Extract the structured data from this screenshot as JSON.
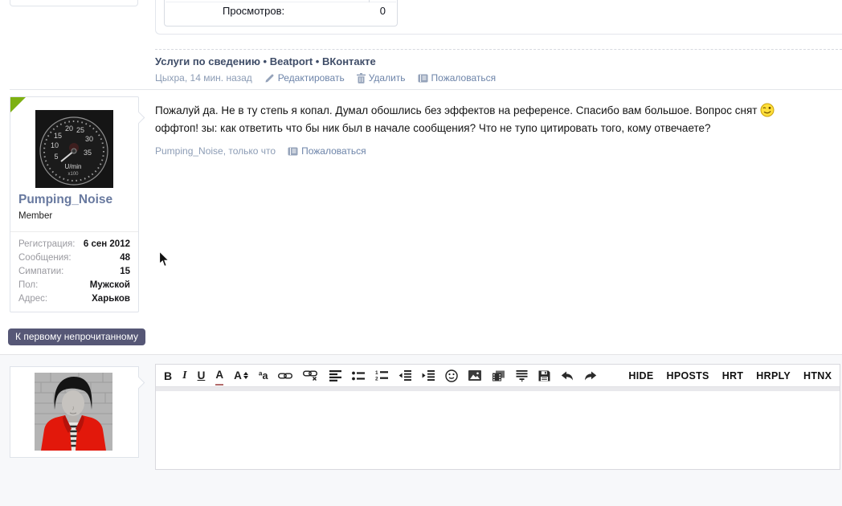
{
  "colors": {
    "link": "#6d84a9",
    "muted_meta": "#8c9cb5",
    "signature_title": "#3f4d68",
    "username": "#68799f",
    "jump_button_bg": "#565776",
    "unread_corner_green": "#7db011",
    "reply_section_bg": "#f7f8fa"
  },
  "prev_post": {
    "stats": {
      "rows": [
        {
          "label": "Просмотров:",
          "value": "0"
        }
      ]
    },
    "signature": "Услуги по сведению • Beatport • ВКонтакте",
    "meta": {
      "author_date": "Цыхра, 14 мин. назад",
      "edit": "Редактировать",
      "delete": "Удалить",
      "report": "Пожаловаться"
    }
  },
  "post": {
    "message_line1": "Пожалуй да. Не в ту степь я копал. Думал обошлись без эффектов на референсе. Спасибо вам большое. Вопрос снят",
    "message_line2": "оффтоп! зы: как ответить что бы ник был в начале сообщения? Что не тупо цитировать того, кому отвечаете?",
    "meta": {
      "author_date": "Pumping_Noise, только что",
      "report": "Пожаловаться"
    }
  },
  "user_card": {
    "username": "Pumping_Noise",
    "user_title": "Member",
    "avatar": "tachometer-gauge-photo",
    "stats": [
      {
        "label": "Регистрация:",
        "value": "6 сен 2012"
      },
      {
        "label": "Сообщения:",
        "value": "48"
      },
      {
        "label": "Симпатии:",
        "value": "15"
      },
      {
        "label": "Пол:",
        "value": "Мужской"
      },
      {
        "label": "Адрес:",
        "value": "Харьков"
      }
    ]
  },
  "jump_button": "К первому непрочитанному",
  "reply": {
    "avatar": "red-jacket-portrait-photo"
  },
  "toolbar": {
    "bold": "B",
    "italic": "I",
    "underline": "U",
    "text_color": "A",
    "font_size": "A",
    "font_family": "ªa",
    "custom_buttons": [
      "HIDE",
      "HPOSTS",
      "HRT",
      "HRPLY",
      "HTNX"
    ],
    "icons": {
      "link-icon": "chain",
      "unlink-icon": "chain-with-x",
      "align-icon": "horizontal-bars",
      "unordered-list-icon": "dots-and-bars",
      "ordered-list-icon": "numbers-and-bars",
      "outdent-icon": "bars-arrow-left",
      "indent-icon": "bars-arrow-right",
      "smiley-icon": "smiling-face-outline",
      "image-icon": "picture-with-mountain",
      "media-icon": "film-frames",
      "quote-block-icon": "text-lines-block",
      "save-icon": "floppy-disk",
      "undo-icon": "curved-arrow-left",
      "redo-icon": "curved-arrow-right"
    }
  },
  "message_icons": {
    "wink-smiley-icon": "yellow-winking-smiley",
    "pencil-icon": "pencil",
    "trash-icon": "trash-can",
    "report-book-icon": "book"
  }
}
